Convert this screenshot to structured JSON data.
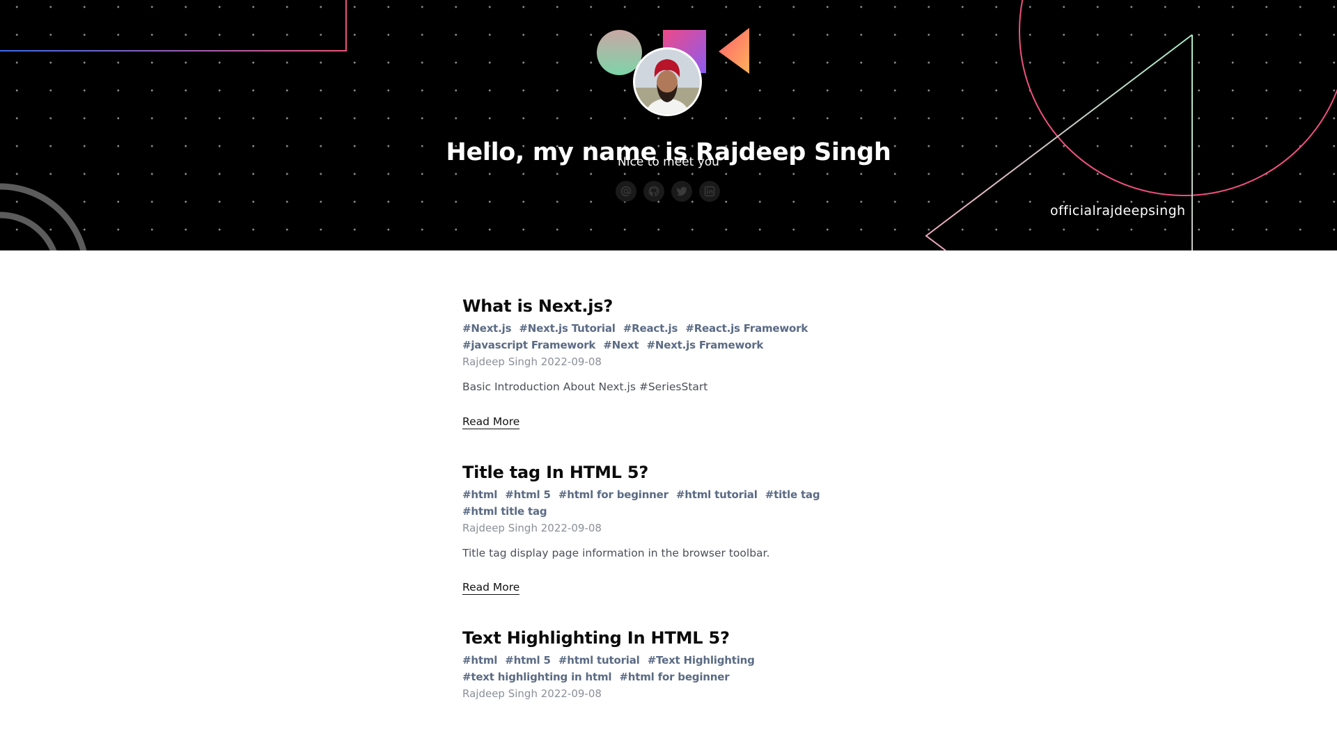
{
  "hero": {
    "title": "Hello, my name is Rajdeep Singh",
    "subtitle": "Nice to meet you",
    "handle": "officialrajdeepsingh",
    "socials": [
      {
        "icon": "at-sign-icon"
      },
      {
        "icon": "github-icon"
      },
      {
        "icon": "twitter-icon"
      },
      {
        "icon": "linkedin-icon"
      }
    ],
    "colors": {
      "pink": "#f0507f",
      "mint": "#a8ecc8",
      "blue": "#3b6df0",
      "orange": "#ff8a4c",
      "purple": "#8a5cf0"
    }
  },
  "posts": [
    {
      "title": "What is Next.js?",
      "tags": [
        "#Next.js",
        "#Next.js Tutorial",
        "#React.js",
        "#React.js Framework",
        "#javascript Framework",
        "#Next",
        "#Next.js Framework"
      ],
      "author": "Rajdeep Singh",
      "date": "2022-09-08",
      "excerpt": "Basic Introduction About Next.js #SeriesStart",
      "read_more": "Read More"
    },
    {
      "title": "Title tag In HTML 5?",
      "tags": [
        "#html",
        "#html 5",
        "#html for beginner",
        "#html tutorial",
        "#title tag",
        "#html title tag"
      ],
      "author": "Rajdeep Singh",
      "date": "2022-09-08",
      "excerpt": "Title tag display page information in the browser toolbar.",
      "read_more": "Read More"
    },
    {
      "title": "Text Highlighting In HTML 5?",
      "tags": [
        "#html",
        "#html 5",
        "#html tutorial",
        "#Text Highlighting",
        "#text highlighting in html",
        "#html for beginner"
      ],
      "author": "Rajdeep Singh",
      "date": "2022-09-08",
      "excerpt": "",
      "read_more": ""
    }
  ]
}
